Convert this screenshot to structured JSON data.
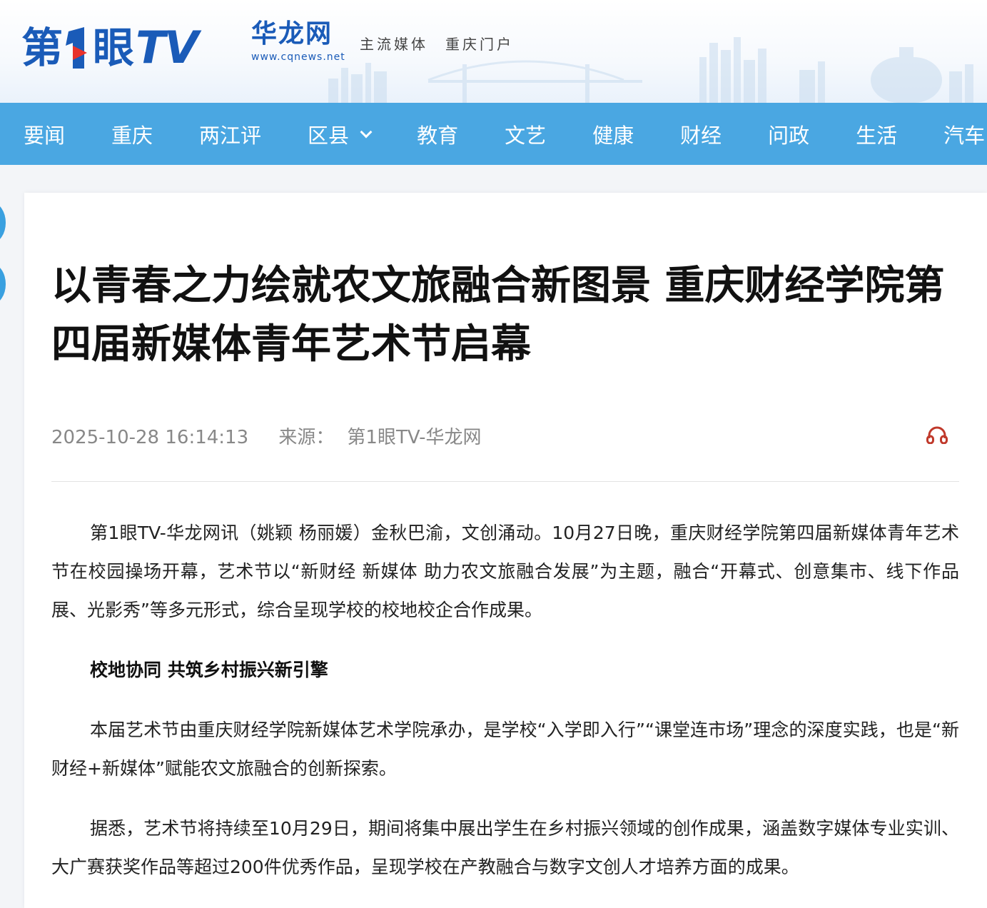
{
  "header": {
    "logo_prefix": "第",
    "logo_eye": "眼",
    "logo_tv": "TV",
    "site_name": "华龙网",
    "site_url": "www.cqnews.net",
    "slogan": "主流媒体　重庆门户"
  },
  "nav": {
    "items": [
      "要闻",
      "重庆",
      "两江评",
      "区县",
      "教育",
      "文艺",
      "健康",
      "财经",
      "问政",
      "生活",
      "汽车"
    ]
  },
  "article": {
    "title": "以青春之力绘就农文旅融合新图景 重庆财经学院第四届新媒体青年艺术节启幕",
    "datetime": "2025-10-28 16:14:13",
    "source_label": "来源：",
    "source": "第1眼TV-华龙网",
    "paragraphs": [
      "第1眼TV-华龙网讯（姚颖 杨丽媛）金秋巴渝，文创涌动。10月27日晚，重庆财经学院第四届新媒体青年艺术节在校园操场开幕，艺术节以“新财经 新媒体 助力农文旅融合发展”为主题，融合“开幕式、创意集市、线下作品展、光影秀”等多元形式，综合呈现学校的校地校企合作成果。",
      "校地协同 共筑乡村振兴新引擎",
      "本届艺术节由重庆财经学院新媒体艺术学院承办，是学校“入学即入行”“课堂连市场”理念的深度实践，也是“新财经+新媒体”赋能农文旅融合的创新探索。",
      "据悉，艺术节将持续至10月29日，期间将集中展出学生在乡村振兴领域的创作成果，涵盖数字媒体专业实训、大广赛获奖作品等超过200件优秀作品，呈现学校在产教融合与数字文创人才培养方面的成果。"
    ]
  },
  "colors": {
    "brand_blue": "#1a5bb8",
    "nav_blue": "#4aa7e2",
    "audio_red": "#c0392b"
  }
}
